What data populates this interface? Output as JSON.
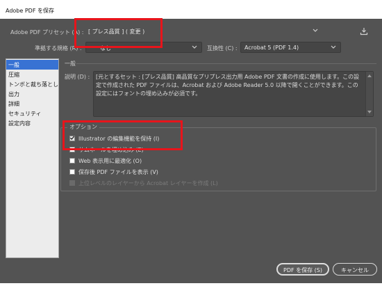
{
  "window": {
    "title": "Adobe PDF を保存"
  },
  "preset": {
    "label": "Adobe PDF プリセット (A) :",
    "value": "[ プレス品質 ] ( 変更 )"
  },
  "standard": {
    "label": "準拠する規格 (R) :",
    "value": "なし"
  },
  "compatibility": {
    "label": "互換性 (C) :",
    "value": "Acrobat 5 (PDF 1.4)"
  },
  "sidebar": {
    "items": [
      {
        "label": "一般",
        "active": true
      },
      {
        "label": "圧縮",
        "active": false
      },
      {
        "label": "トンボと裁ち落とし",
        "active": false
      },
      {
        "label": "出力",
        "active": false
      },
      {
        "label": "詳細",
        "active": false
      },
      {
        "label": "セキュリティ",
        "active": false
      },
      {
        "label": "設定内容",
        "active": false
      }
    ]
  },
  "general": {
    "heading": "一般",
    "desc_label": "説明 (D) :",
    "description": "[元とするセット : [プレス品質] 高品質なプリプレス出力用 Adobe PDF 文書の作成に使用します。この設定で作成された PDF ファイルは、Acrobat および Adobe Reader 5.0 以降で開くことができます。この設定にはフォントの埋め込みが必須です。"
  },
  "options": {
    "heading": "オプション",
    "items": [
      {
        "label": "Illustrator の編集機能を保持 (I)",
        "checked": true,
        "enabled": true
      },
      {
        "label": "サムネールを埋め込み (E)",
        "checked": false,
        "enabled": true
      },
      {
        "label": "Web 表示用に最適化 (O)",
        "checked": false,
        "enabled": true
      },
      {
        "label": "保存後 PDF ファイルを表示 (V)",
        "checked": false,
        "enabled": true
      },
      {
        "label": "上位レベルのレイヤーから Acrobat レイヤーを作成 (L)",
        "checked": false,
        "enabled": false
      }
    ]
  },
  "buttons": {
    "save": "PDF を保存 (S)",
    "cancel": "キャンセル"
  },
  "colors": {
    "background": "#535353",
    "highlight": "#e8141b",
    "selection": "#3872d3"
  }
}
